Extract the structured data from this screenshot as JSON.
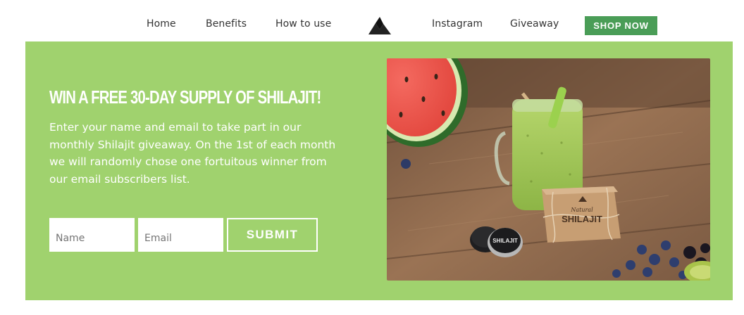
{
  "nav": {
    "links": [
      "Home",
      "Benefits",
      "How to use",
      "Instagram",
      "Giveaway"
    ],
    "shop_label": "SHOP NOW",
    "logo_icon": "mountain-logo-icon"
  },
  "giveaway": {
    "title": "WIN A FREE 30-DAY SUPPLY OF SHILAJIT!",
    "description": "Enter your name and email to take part in our monthly Shilajit giveaway. On the 1st of each month we will randomly chose one fortuitous winner from our email subscribers list.",
    "name_placeholder": "Name",
    "email_placeholder": "Email",
    "submit_label": "SUBMIT"
  },
  "photo": {
    "box_label_top": "Natural",
    "box_label_main": "SHILAJIT",
    "jar_label": "SHILAJIT"
  },
  "colors": {
    "panel_green": "#a0d26e",
    "button_green": "#4a9d57",
    "wood": "#8a6446"
  }
}
